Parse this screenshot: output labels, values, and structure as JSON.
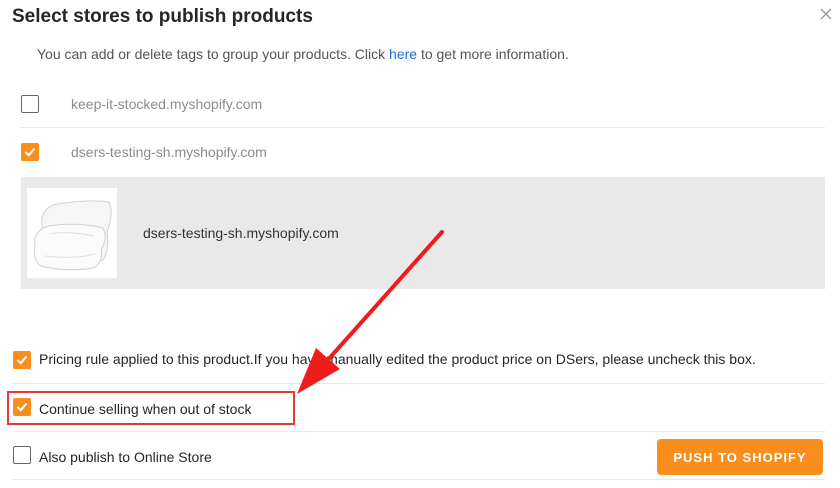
{
  "dialog": {
    "title": "Select stores to publish products",
    "intro_before": "You can add or delete tags to group your products. Click ",
    "intro_link": "here",
    "intro_after": " to get more information."
  },
  "stores": [
    {
      "name": "keep-it-stocked.myshopify.com",
      "checked": false
    },
    {
      "name": "dsers-testing-sh.myshopify.com",
      "checked": true
    }
  ],
  "selected_store_panel": {
    "store_name": "dsers-testing-sh.myshopify.com"
  },
  "options": {
    "pricing_rule": {
      "label": "Pricing rule applied to this product.If you have manually edited the product price on DSers, please uncheck this box.",
      "checked": true
    },
    "continue_selling": {
      "label": "Continue selling when out of stock",
      "checked": true
    },
    "online_store": {
      "label": "Also publish to Online Store",
      "checked": false
    }
  },
  "actions": {
    "push_label": "PUSH TO SHOPIFY"
  },
  "colors": {
    "accent": "#f78e1e",
    "annotation": "#e53935",
    "link": "#1a6fd6"
  }
}
